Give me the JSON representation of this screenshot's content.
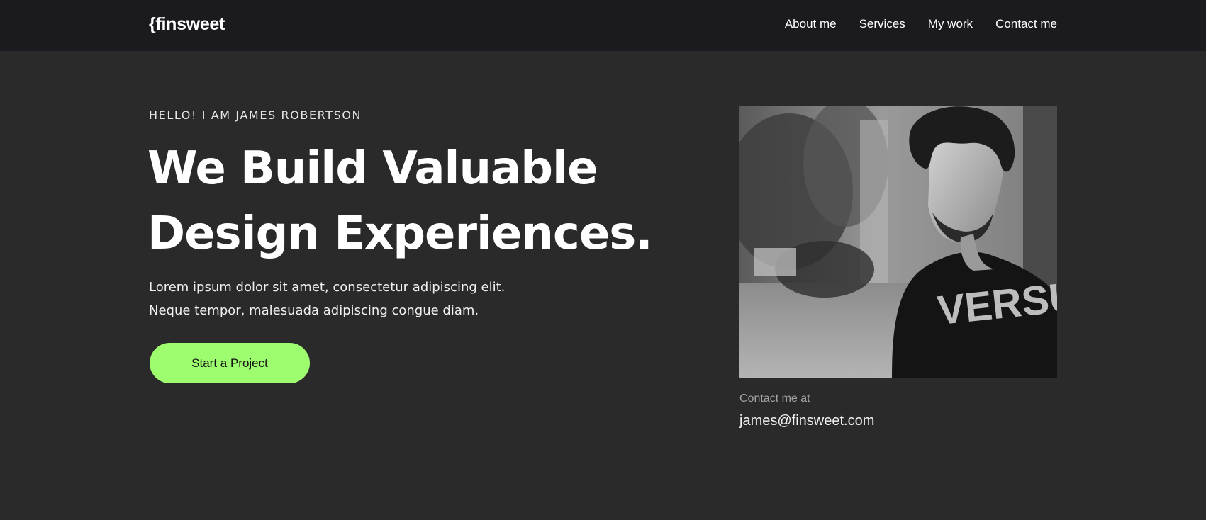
{
  "nav": {
    "logo": "{finsweet",
    "links": [
      "About me",
      "Services",
      "My work",
      "Contact me"
    ]
  },
  "hero": {
    "eyebrow": "HELLO! I AM JAMES ROBERTSON",
    "headline": [
      "We Build Valuable",
      "Design Experiences."
    ],
    "lead": [
      "Lorem ipsum dolor sit amet, consectetur adipiscing elit.",
      "Neque tempor, malesuada adipiscing congue diam."
    ],
    "cta_label": "Start a Project"
  },
  "photo": {
    "shirt_text": "VERSUS"
  },
  "contact": {
    "label": "Contact me at",
    "email": "james@finsweet.com"
  },
  "colors": {
    "background": "#2a2a2a",
    "navbar": "#1b1a1f",
    "accent": "#9efd6f"
  }
}
